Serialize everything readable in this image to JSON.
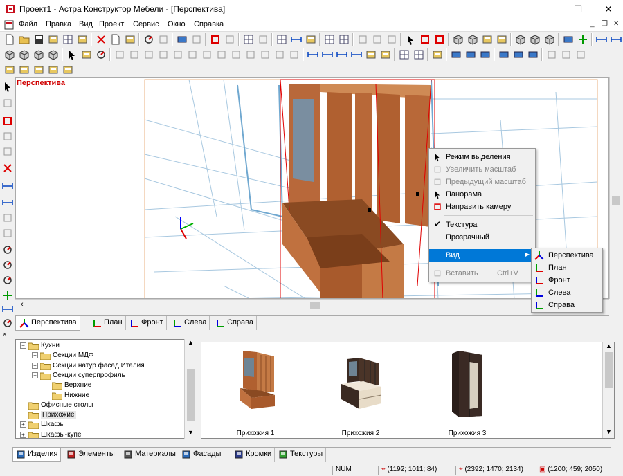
{
  "window": {
    "title": "Проект1 - Астра Конструктор Мебели - [Перспектива]",
    "minimize": "—",
    "maximize": "☐",
    "close": "✕",
    "mdi_min": "_",
    "mdi_restore": "❐",
    "mdi_close": "✕"
  },
  "menu": [
    "Файл",
    "Правка",
    "Вид",
    "Проект",
    "Сервис",
    "Окно",
    "Справка"
  ],
  "viewport": {
    "label": "Перспектива",
    "accent": "#d00000"
  },
  "context_menu": {
    "items": [
      {
        "label": "Режим выделения",
        "enabled": true,
        "icon": "cursor-icon"
      },
      {
        "label": "Увеличить масштаб",
        "enabled": false,
        "icon": "zoom-in-icon"
      },
      {
        "label": "Предыдущий масштаб",
        "enabled": false,
        "icon": "zoom-previous-icon"
      },
      {
        "label": "Панорама",
        "enabled": true,
        "icon": "pan-icon"
      },
      {
        "label": "Направить камеру",
        "enabled": true,
        "icon": "camera-target-icon"
      },
      {
        "label": "Текстура",
        "enabled": true,
        "checked": true,
        "icon": "check-icon"
      },
      {
        "label": "Прозрачный",
        "enabled": true,
        "icon": ""
      },
      {
        "label": "Вид",
        "enabled": true,
        "highlighted": true,
        "submenu": true
      },
      {
        "label": "Вставить",
        "enabled": false,
        "shortcut": "Ctrl+V",
        "icon": "paste-icon"
      }
    ],
    "submenu_arrow": "▶"
  },
  "view_submenu": [
    {
      "label": "Перспектива",
      "icon": "perspective-axes-icon"
    },
    {
      "label": "План",
      "icon": "plan-axes-icon"
    },
    {
      "label": "Фронт",
      "icon": "front-axes-icon"
    },
    {
      "label": "Слева",
      "icon": "left-axes-icon"
    },
    {
      "label": "Справа",
      "icon": "right-axes-icon"
    }
  ],
  "view_tabs": [
    {
      "label": "Перспектива",
      "active": true
    },
    {
      "label": "План",
      "active": false
    },
    {
      "label": "Фронт",
      "active": false
    },
    {
      "label": "Слева",
      "active": false
    },
    {
      "label": "Справа",
      "active": false
    }
  ],
  "tree": [
    {
      "label": "Кухни",
      "level": 0,
      "expander": "⊟"
    },
    {
      "label": "Секции МДФ",
      "level": 1,
      "expander": "+"
    },
    {
      "label": "Секции натур фасад Италия",
      "level": 1,
      "expander": "+"
    },
    {
      "label": "Секции суперпрофиль",
      "level": 1,
      "expander": "−"
    },
    {
      "label": "Верхние",
      "level": 2,
      "expander": ""
    },
    {
      "label": "Нижние",
      "level": 2,
      "expander": ""
    },
    {
      "label": "Офисные столы",
      "level": 0,
      "expander": ""
    },
    {
      "label": "Прихожие",
      "level": 0,
      "expander": "",
      "selected": true
    },
    {
      "label": "Шкафы",
      "level": 0,
      "expander": "+"
    },
    {
      "label": "Шкафы-купе",
      "level": 0,
      "expander": "+"
    }
  ],
  "gallery": [
    {
      "caption": "Прихожия 1"
    },
    {
      "caption": "Прихожия 2"
    },
    {
      "caption": "Прихожия 3"
    }
  ],
  "bottom_tabs": [
    {
      "label": "Изделия",
      "active": true,
      "icon": "cabinet-icon"
    },
    {
      "label": "Элементы",
      "active": false,
      "icon": "element-icon"
    },
    {
      "label": "Материалы",
      "active": false,
      "icon": "materials-icon"
    },
    {
      "label": "Фасады",
      "active": false,
      "icon": "facade-icon"
    },
    {
      "label": "Кромки",
      "active": false,
      "icon": "edge-icon"
    },
    {
      "label": "Текстуры",
      "active": false,
      "icon": "texture-icon"
    }
  ],
  "status": {
    "num": "NUM",
    "coord1": "(1192; 1011; 84)",
    "coord2": "(2392; 1470; 2134)",
    "coord3": "(1200; 459; 2050)"
  }
}
